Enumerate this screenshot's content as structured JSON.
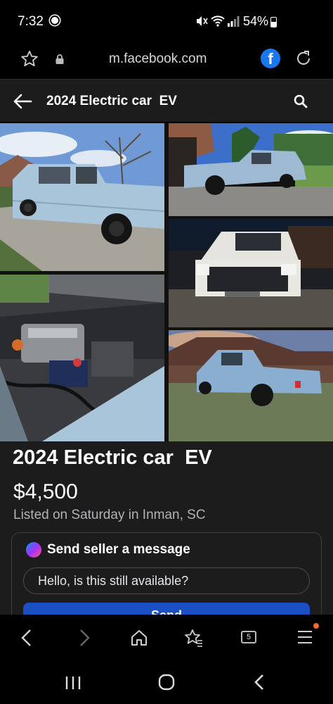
{
  "status_bar": {
    "time": "7:32",
    "battery": "54%"
  },
  "browser": {
    "url": "m.facebook.com"
  },
  "header": {
    "title": "2024 Electric car  EV"
  },
  "listing": {
    "title": "2024 Electric car  EV",
    "price": "$4,500",
    "listed": "Listed on Saturday in Inman, SC"
  },
  "message": {
    "label": "Send seller a message",
    "input_value": "Hello, is this still available?",
    "send_label": "Send"
  },
  "toolbar": {
    "tab_count": "5"
  },
  "colors": {
    "accent": "#1877f2",
    "send_button": "#1b4fc4",
    "card_bg": "#1c1c1c"
  }
}
